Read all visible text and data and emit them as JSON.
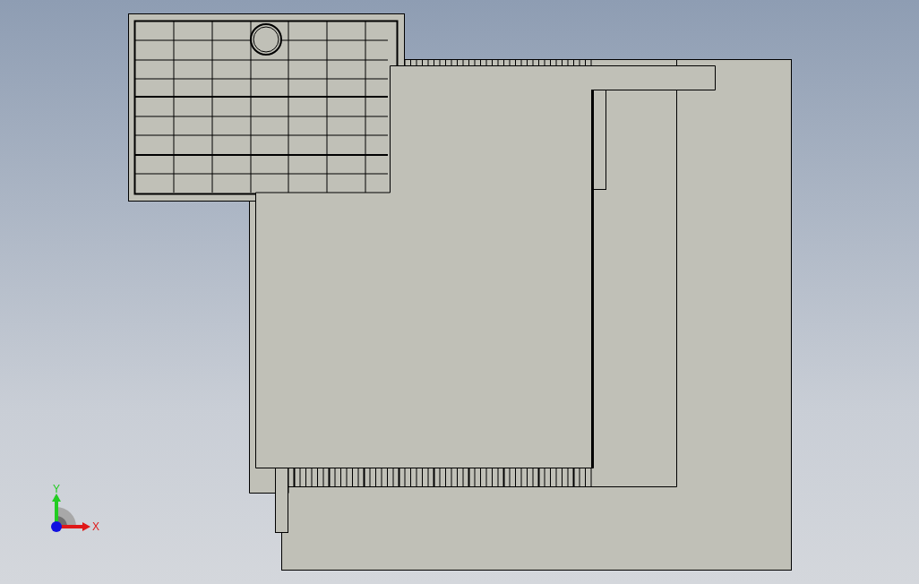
{
  "viewport": {
    "triad": {
      "labels": [
        {
          "kind": "vertical",
          "text": "Y"
        },
        {
          "kind": "horizontal",
          "text": "X"
        }
      ]
    }
  }
}
